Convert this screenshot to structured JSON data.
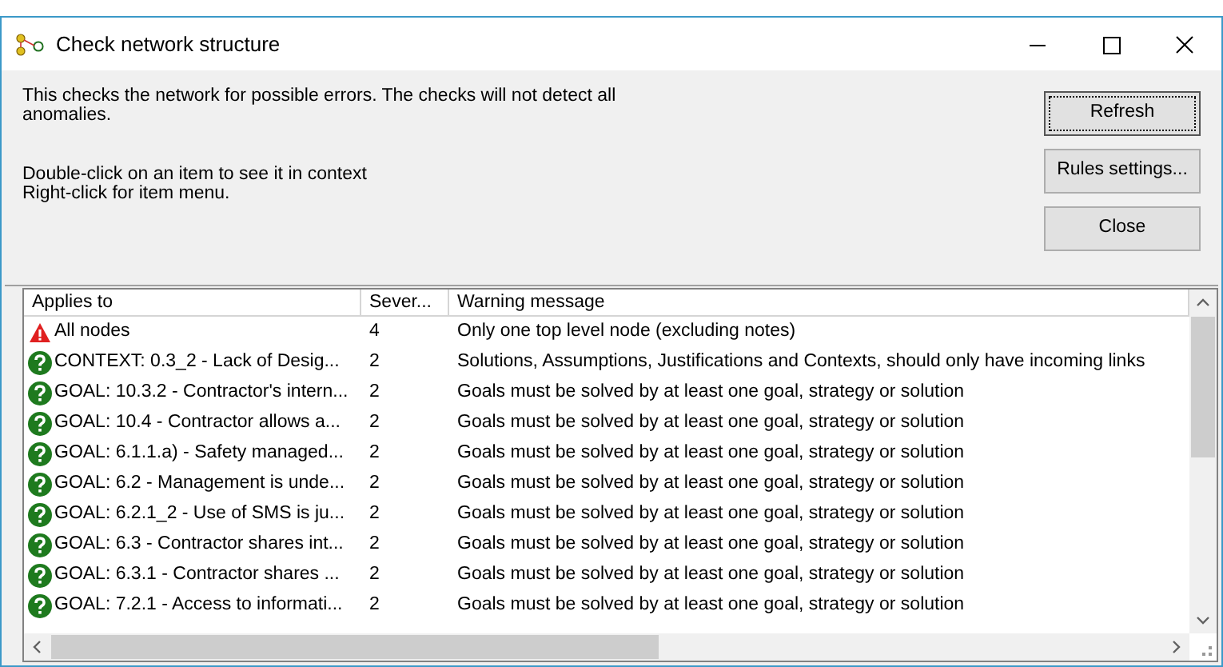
{
  "window": {
    "title": "Check network structure"
  },
  "info": {
    "description": "This checks the network for possible errors. The checks will not detect all anomalies.",
    "hint_lines": [
      "Double-click on an item to see it in context",
      "Right-click for item menu."
    ]
  },
  "buttons": [
    {
      "label": "Refresh",
      "focused": true
    },
    {
      "label": "Rules settings...",
      "focused": false
    },
    {
      "label": "Close",
      "focused": false
    }
  ],
  "table": {
    "columns": [
      "Applies to",
      "Sever...",
      "Warning message"
    ],
    "rows": [
      {
        "kind": "error",
        "applies_to": "All nodes",
        "severity": "4",
        "message": "Only one top level node (excluding notes)"
      },
      {
        "kind": "question",
        "applies_to": "CONTEXT: 0.3_2 - Lack of Desig...",
        "severity": "2",
        "message": "Solutions, Assumptions, Justifications and Contexts, should only have incoming links"
      },
      {
        "kind": "question",
        "applies_to": "GOAL: 10.3.2 - Contractor's intern...",
        "severity": "2",
        "message": "Goals must be solved by at least one goal, strategy or solution"
      },
      {
        "kind": "question",
        "applies_to": "GOAL: 10.4 - Contractor allows a...",
        "severity": "2",
        "message": "Goals must be solved by at least one goal, strategy or solution"
      },
      {
        "kind": "question",
        "applies_to": "GOAL: 6.1.1.a) - Safety managed...",
        "severity": "2",
        "message": "Goals must be solved by at least one goal, strategy or solution"
      },
      {
        "kind": "question",
        "applies_to": "GOAL: 6.2 - Management is unde...",
        "severity": "2",
        "message": "Goals must be solved by at least one goal, strategy or solution"
      },
      {
        "kind": "question",
        "applies_to": "GOAL: 6.2.1_2 - Use of SMS is ju...",
        "severity": "2",
        "message": "Goals must be solved by at least one goal, strategy or solution"
      },
      {
        "kind": "question",
        "applies_to": "GOAL: 6.3 - Contractor shares int...",
        "severity": "2",
        "message": "Goals must be solved by at least one goal, strategy or solution"
      },
      {
        "kind": "question",
        "applies_to": "GOAL: 6.3.1 - Contractor shares ...",
        "severity": "2",
        "message": "Goals must be solved by at least one goal, strategy or solution"
      },
      {
        "kind": "question",
        "applies_to": "GOAL: 7.2.1 - Access to informati...",
        "severity": "2",
        "message": "Goals must be solved by at least one goal, strategy or solution"
      }
    ]
  }
}
